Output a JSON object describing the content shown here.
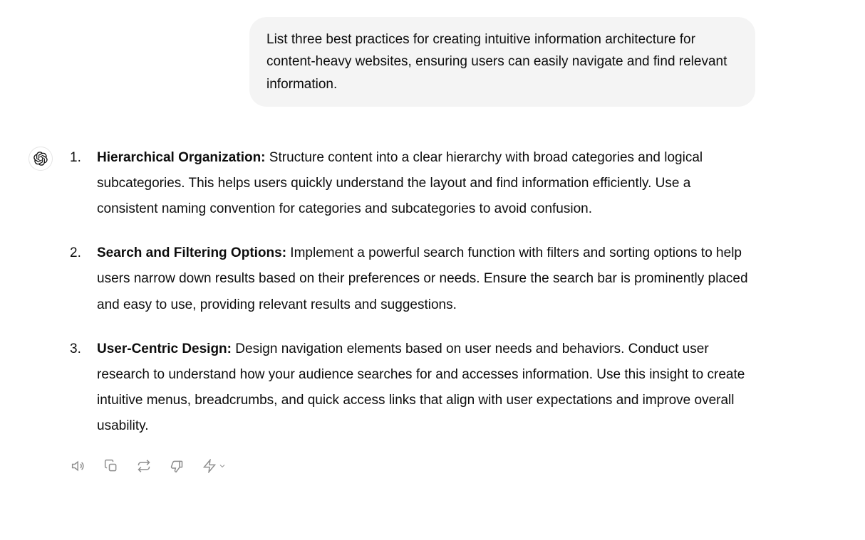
{
  "user_message": "List three best practices for creating intuitive information architecture for content-heavy websites, ensuring users can easily navigate and find relevant information.",
  "assistant": {
    "items": [
      {
        "title": "Hierarchical Organization:",
        "body": " Structure content into a clear hierarchy with broad categories and logical subcategories. This helps users quickly understand the layout and find information efficiently. Use a consistent naming convention for categories and subcategories to avoid confusion."
      },
      {
        "title": "Search and Filtering Options:",
        "body": " Implement a powerful search function with filters and sorting options to help users narrow down results based on their preferences or needs. Ensure the search bar is prominently placed and easy to use, providing relevant results and suggestions."
      },
      {
        "title": "User-Centric Design:",
        "body": " Design navigation elements based on user needs and behaviors. Conduct user research to understand how your audience searches for and accesses information. Use this insight to create intuitive menus, breadcrumbs, and quick access links that align with user expectations and improve overall usability."
      }
    ]
  },
  "actions": {
    "read_aloud": "Read aloud",
    "copy": "Copy",
    "regenerate": "Regenerate",
    "bad_response": "Bad response",
    "insight": "Insight"
  }
}
